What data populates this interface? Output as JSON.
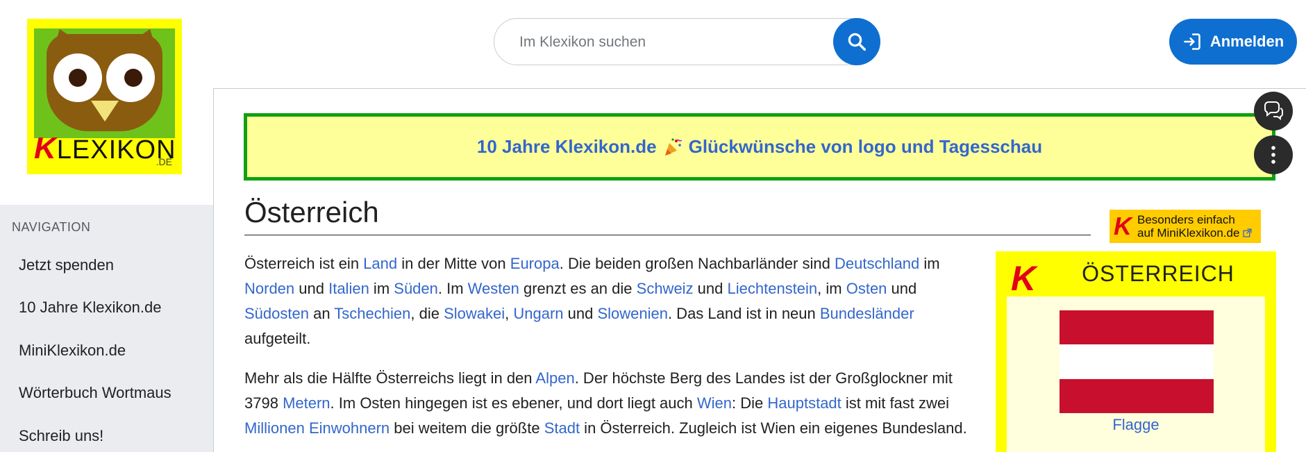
{
  "logo": {
    "letter_k": "K",
    "word": "LEXIKON",
    "suffix": ".DE"
  },
  "search": {
    "placeholder": "Im Klexikon suchen",
    "value": ""
  },
  "header": {
    "login_label": "Anmelden"
  },
  "sidebar": {
    "heading": "NAVIGATION",
    "items": [
      "Jetzt spenden",
      "10 Jahre Klexikon.de",
      "MiniKlexikon.de",
      "Wörterbuch Wortmaus",
      "Schreib uns!"
    ]
  },
  "banner": {
    "part1": "10 Jahre Klexikon.de",
    "part2": "Glückwünsche von logo und Tagesschau"
  },
  "article": {
    "title": "Österreich",
    "mini_letter": "K",
    "mini_line1": "Besonders einfach",
    "mini_line2": "auf MiniKlexikon.de",
    "p1": [
      {
        "t": "Österreich ist ein "
      },
      {
        "t": "Land",
        "l": true
      },
      {
        "t": " in der Mitte von "
      },
      {
        "t": "Europa",
        "l": true
      },
      {
        "t": ". Die beiden großen Nachbarländer sind "
      },
      {
        "t": "Deutschland",
        "l": true
      },
      {
        "t": " im "
      },
      {
        "t": "Norden",
        "l": true
      },
      {
        "t": " und "
      },
      {
        "t": "Italien",
        "l": true
      },
      {
        "t": " im "
      },
      {
        "t": "Süden",
        "l": true
      },
      {
        "t": ". Im "
      },
      {
        "t": "Westen",
        "l": true
      },
      {
        "t": " grenzt es an die "
      },
      {
        "t": "Schweiz",
        "l": true
      },
      {
        "t": " und "
      },
      {
        "t": "Liechtenstein",
        "l": true
      },
      {
        "t": ", im "
      },
      {
        "t": "Osten",
        "l": true
      },
      {
        "t": " und "
      },
      {
        "t": "Südosten",
        "l": true
      },
      {
        "t": " an "
      },
      {
        "t": "Tschechien",
        "l": true
      },
      {
        "t": ", die "
      },
      {
        "t": "Slowakei",
        "l": true
      },
      {
        "t": ", "
      },
      {
        "t": "Ungarn",
        "l": true
      },
      {
        "t": " und "
      },
      {
        "t": "Slowenien",
        "l": true
      },
      {
        "t": ". Das Land ist in neun "
      },
      {
        "t": "Bundesländer",
        "l": true
      },
      {
        "t": " aufgeteilt."
      }
    ],
    "p2": [
      {
        "t": "Mehr als die Hälfte Österreichs liegt in den "
      },
      {
        "t": "Alpen",
        "l": true
      },
      {
        "t": ". Der höchste Berg des Landes ist der Großglockner mit 3798 "
      },
      {
        "t": "Metern",
        "l": true
      },
      {
        "t": ". Im Osten hingegen ist es ebener, und dort liegt auch "
      },
      {
        "t": "Wien",
        "l": true
      },
      {
        "t": ": Die "
      },
      {
        "t": "Hauptstadt",
        "l": true
      },
      {
        "t": " ist mit fast zwei "
      },
      {
        "t": "Millionen",
        "l": true
      },
      {
        "t": " "
      },
      {
        "t": "Einwohnern",
        "l": true
      },
      {
        "t": " bei weitem die größte "
      },
      {
        "t": "Stadt",
        "l": true
      },
      {
        "t": " in Österreich. Zugleich ist Wien ein eigenes Bundesland."
      }
    ]
  },
  "infobox": {
    "letter": "K",
    "name": "ÖSTERREICH",
    "flag_caption": "Flagge",
    "flag_colors": [
      "#c8102e",
      "#ffffff",
      "#c8102e"
    ]
  },
  "colors": {
    "accent": "#0e6fd0",
    "link": "#3366cc",
    "banner_border": "#11a011",
    "banner_bg": "#ffff99"
  },
  "icons": {
    "search": "search-icon",
    "login": "login-icon",
    "chat": "chat-icon",
    "more": "more-vertical-icon",
    "external": "external-link-icon"
  }
}
